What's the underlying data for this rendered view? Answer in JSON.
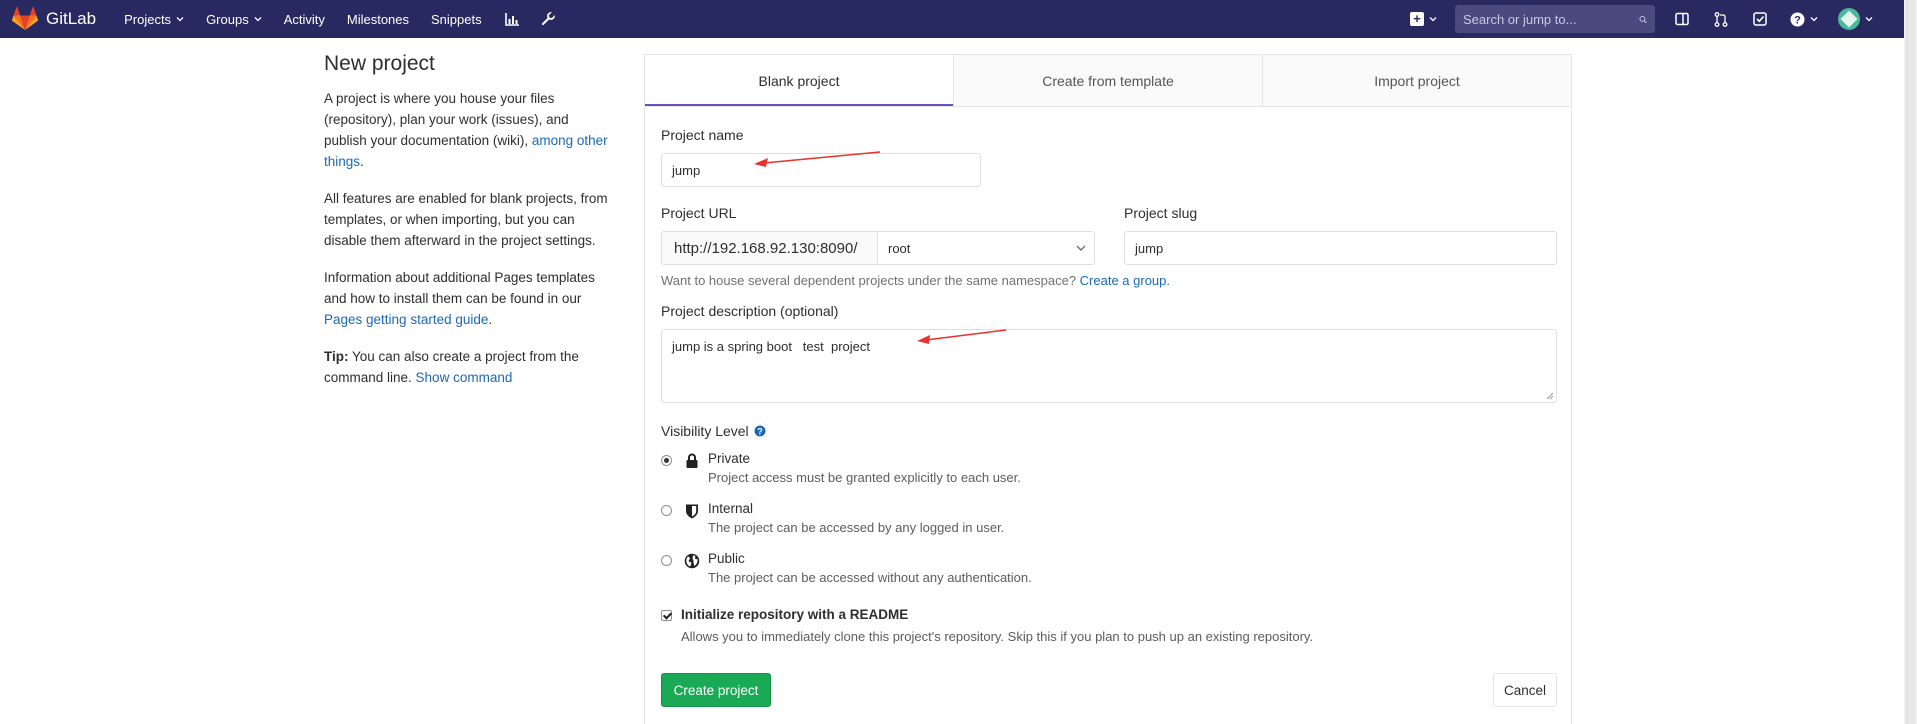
{
  "navbar": {
    "brand": "GitLab",
    "links": [
      {
        "label": "Projects",
        "dropdown": true
      },
      {
        "label": "Groups",
        "dropdown": true
      },
      {
        "label": "Activity",
        "dropdown": false
      },
      {
        "label": "Milestones",
        "dropdown": false
      },
      {
        "label": "Snippets",
        "dropdown": false
      }
    ],
    "search_placeholder": "Search or jump to...",
    "icons": [
      "chart-icon",
      "wrench-icon",
      "plus-square-icon",
      "search-icon",
      "sidebar-icon",
      "merge-request-icon",
      "todo-check-icon",
      "help-icon",
      "avatar"
    ]
  },
  "info": {
    "title": "New project",
    "para1_text": "A project is where you house your files (repository), plan your work (issues), and publish your documentation (wiki), ",
    "para1_link": "among other things",
    "para1_end": ".",
    "para2": "All features are enabled for blank projects, from templates, or when importing, but you can disable them afterward in the project settings.",
    "para3_text": "Information about additional Pages templates and how to install them can be found in our ",
    "para3_link": "Pages getting started guide",
    "para3_end": ".",
    "tip_label": "Tip:",
    "tip_text": " You can also create a project from the command line. ",
    "tip_link": "Show command"
  },
  "tabs": [
    {
      "label": "Blank project",
      "active": true
    },
    {
      "label": "Create from template",
      "active": false
    },
    {
      "label": "Import project",
      "active": false
    }
  ],
  "form": {
    "project_name_label": "Project name",
    "project_name_value": "jump",
    "project_url_label": "Project URL",
    "project_url_prefix": "http://192.168.92.130:8090/",
    "namespace_value": "root",
    "project_slug_label": "Project slug",
    "project_slug_value": "jump",
    "namespace_help": "Want to house several dependent projects under the same namespace? ",
    "namespace_help_link": "Create a group.",
    "description_label": "Project description (optional)",
    "description_value": "jump is a spring boot   test  project",
    "visibility_label": "Visibility Level",
    "visibility_options": [
      {
        "title": "Private",
        "desc": "Project access must be granted explicitly to each user.",
        "checked": true,
        "icon": "lock-icon"
      },
      {
        "title": "Internal",
        "desc": "The project can be accessed by any logged in user.",
        "checked": false,
        "icon": "shield-icon"
      },
      {
        "title": "Public",
        "desc": "The project can be accessed without any authentication.",
        "checked": false,
        "icon": "globe-icon"
      }
    ],
    "readme_label": "Initialize repository with a README",
    "readme_desc": "Allows you to immediately clone this project's repository. Skip this if you plan to push up an existing repository.",
    "readme_checked": true,
    "create_button": "Create project",
    "cancel_button": "Cancel"
  },
  "colors": {
    "navbar": "#292961",
    "primary_button": "#1aaa55",
    "link": "#1b69b6",
    "active_tab_underline": "#6b4fbb",
    "annotation_arrow": "#e8322d"
  }
}
